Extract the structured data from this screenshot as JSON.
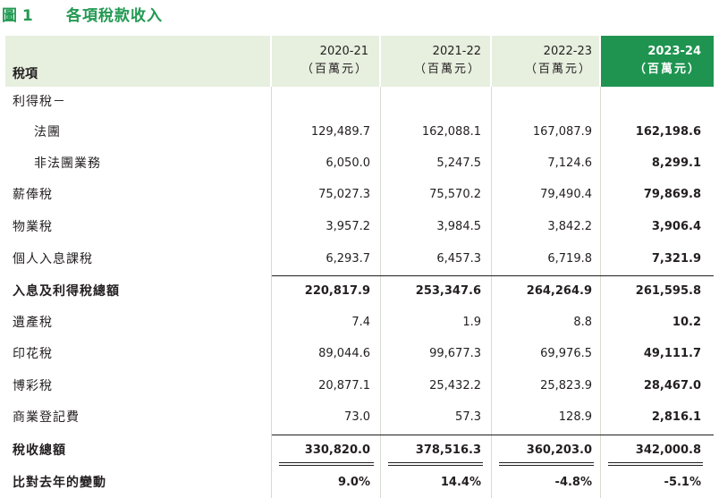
{
  "figure": {
    "number": "圖 1",
    "title": "各項稅款收入"
  },
  "table": {
    "label_header": "稅項",
    "columns": [
      {
        "year": "2020-21",
        "unit": "（百萬元）"
      },
      {
        "year": "2021-22",
        "unit": "（百萬元）"
      },
      {
        "year": "2022-23",
        "unit": "（百萬元）"
      },
      {
        "year": "2023-24",
        "unit": "（百萬元）"
      }
    ],
    "highlight_color": "#1e9450",
    "header_bg_color": "#e7efdf",
    "rows": [
      {
        "label": "利得稅－",
        "values": [
          "",
          "",
          "",
          ""
        ]
      },
      {
        "label": "法團",
        "values": [
          "129,489.7",
          "162,088.1",
          "167,087.9",
          "162,198.6"
        ]
      },
      {
        "label": "非法團業務",
        "values": [
          "6,050.0",
          "5,247.5",
          "7,124.6",
          "8,299.1"
        ]
      },
      {
        "label": "薪俸稅",
        "values": [
          "75,027.3",
          "75,570.2",
          "79,490.4",
          "79,869.8"
        ]
      },
      {
        "label": "物業稅",
        "values": [
          "3,957.2",
          "3,984.5",
          "3,842.2",
          "3,906.4"
        ]
      },
      {
        "label": "個人入息課稅",
        "values": [
          "6,293.7",
          "6,457.3",
          "6,719.8",
          "7,321.9"
        ]
      },
      {
        "label": "入息及利得稅總額",
        "values": [
          "220,817.9",
          "253,347.6",
          "264,264.9",
          "261,595.8"
        ]
      },
      {
        "label": "遺產稅",
        "values": [
          "7.4",
          "1.9",
          "8.8",
          "10.2"
        ]
      },
      {
        "label": "印花稅",
        "values": [
          "89,044.6",
          "99,677.3",
          "69,976.5",
          "49,111.7"
        ]
      },
      {
        "label": "博彩稅",
        "values": [
          "20,877.1",
          "25,432.2",
          "25,823.9",
          "28,467.0"
        ]
      },
      {
        "label": "商業登記費",
        "values": [
          "73.0",
          "57.3",
          "128.9",
          "2,816.1"
        ]
      },
      {
        "label": "稅收總額",
        "values": [
          "330,820.0",
          "378,516.3",
          "360,203.0",
          "342,000.8"
        ]
      },
      {
        "label": "比對去年的變動",
        "values": [
          "9.0%",
          "14.4%",
          "-4.8%",
          "-5.1%"
        ]
      }
    ]
  }
}
